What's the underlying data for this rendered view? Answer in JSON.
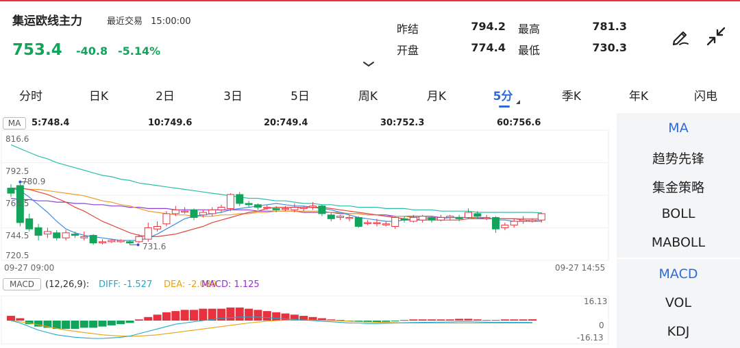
{
  "header": {
    "title": "集运欧线主力",
    "status_label": "最近交易",
    "status_time": "15:00:00",
    "price": "753.4",
    "change": "-40.8",
    "change_pct": "-5.14%",
    "quote": {
      "prev_settle_label": "昨结",
      "prev_settle": "794.2",
      "high_label": "最高",
      "high": "781.3",
      "open_label": "开盘",
      "open": "774.4",
      "low_label": "最低",
      "low": "730.3"
    },
    "icons": [
      "draw-pen-icon",
      "collapse-icon",
      "chevron-down-icon"
    ]
  },
  "tabs": [
    {
      "label": "分时"
    },
    {
      "label": "日K"
    },
    {
      "label": "2日"
    },
    {
      "label": "3日"
    },
    {
      "label": "5日"
    },
    {
      "label": "周K"
    },
    {
      "label": "月K"
    },
    {
      "label": "5分",
      "active": true
    },
    {
      "label": "季K"
    },
    {
      "label": "年K"
    },
    {
      "label": "闪电"
    }
  ],
  "ma_indicator": {
    "tag": "MA",
    "values": [
      {
        "text": "5:748.4",
        "color": "#3d8ee0"
      },
      {
        "text": "10:749.6",
        "color": "#e0463e"
      },
      {
        "text": "20:749.4",
        "color": "#f09a2a"
      },
      {
        "text": "30:752.3",
        "color": "#1f3fb8"
      },
      {
        "text": "60:756.6",
        "color": "#2bbfa6"
      }
    ]
  },
  "macd_indicator": {
    "tag": "MACD",
    "params": "(12,26,9):",
    "diff": "DIFF: -1.527",
    "dea": "DEA: -2.089",
    "macd": "MACD: 1.125",
    "diff_color": "#22a8c9",
    "dea_color": "#e8a20f",
    "macd_color": "#9b2fd0"
  },
  "axis": {
    "price_ticks": [
      "816.6",
      "792.5",
      "768.5",
      "744.5",
      "720.5"
    ],
    "time_start": "09-27 09:00",
    "time_end": "09-27 14:55",
    "macd_ticks": [
      "16.13",
      "0",
      "-16.13"
    ],
    "max_label": "780.9",
    "min_label": "731.6"
  },
  "side_panel": {
    "main_items": [
      {
        "label": "MA",
        "active": true
      },
      {
        "label": "趋势先锋"
      },
      {
        "label": "集金策略"
      },
      {
        "label": "BOLL"
      },
      {
        "label": "MABOLL"
      }
    ],
    "sub_items": [
      {
        "label": "MACD",
        "active": true
      },
      {
        "label": "VOL"
      },
      {
        "label": "KDJ"
      }
    ]
  },
  "colors": {
    "up": "#e8313f",
    "down": "#13a45b",
    "accent": "#2d6ad8"
  },
  "chart_data": {
    "type": "candlestick",
    "y_range": [
      720.5,
      816.6
    ],
    "candles": [
      {
        "o": 776,
        "c": 772,
        "h": 779,
        "l": 769
      },
      {
        "o": 778,
        "c": 749,
        "h": 780.9,
        "l": 746
      },
      {
        "o": 752,
        "c": 744,
        "h": 756,
        "l": 742
      },
      {
        "o": 745,
        "c": 739,
        "h": 748,
        "l": 735
      },
      {
        "o": 740,
        "c": 742,
        "h": 745,
        "l": 737
      },
      {
        "o": 741,
        "c": 737,
        "h": 743,
        "l": 735
      },
      {
        "o": 737,
        "c": 741,
        "h": 743,
        "l": 735
      },
      {
        "o": 740,
        "c": 739,
        "h": 742,
        "l": 737
      },
      {
        "o": 737,
        "c": 738,
        "h": 742,
        "l": 735
      },
      {
        "o": 739,
        "c": 733,
        "h": 740,
        "l": 731.6
      },
      {
        "o": 734,
        "c": 734,
        "h": 736,
        "l": 732
      },
      {
        "o": 734,
        "c": 735,
        "h": 736,
        "l": 733
      },
      {
        "o": 734,
        "c": 735,
        "h": 736,
        "l": 733
      },
      {
        "o": 734,
        "c": 733,
        "h": 735,
        "l": 731.6
      },
      {
        "o": 734,
        "c": 738,
        "h": 740,
        "l": 733
      },
      {
        "o": 736,
        "c": 745,
        "h": 749,
        "l": 734
      },
      {
        "o": 744,
        "c": 746,
        "h": 750,
        "l": 742
      },
      {
        "o": 748,
        "c": 756,
        "h": 758,
        "l": 746
      },
      {
        "o": 756,
        "c": 759,
        "h": 762,
        "l": 754
      },
      {
        "o": 758,
        "c": 758,
        "h": 761,
        "l": 756
      },
      {
        "o": 759,
        "c": 753,
        "h": 760,
        "l": 751
      },
      {
        "o": 755,
        "c": 757,
        "h": 759,
        "l": 753
      },
      {
        "o": 756,
        "c": 759,
        "h": 761,
        "l": 754
      },
      {
        "o": 759,
        "c": 761,
        "h": 763,
        "l": 757
      },
      {
        "o": 760,
        "c": 771,
        "h": 772,
        "l": 758
      },
      {
        "o": 771,
        "c": 764,
        "h": 773,
        "l": 762
      },
      {
        "o": 764,
        "c": 763,
        "h": 766,
        "l": 761
      },
      {
        "o": 763,
        "c": 761,
        "h": 764,
        "l": 759
      },
      {
        "o": 761,
        "c": 761,
        "h": 763,
        "l": 759
      },
      {
        "o": 760,
        "c": 759,
        "h": 762,
        "l": 757
      },
      {
        "o": 760,
        "c": 760,
        "h": 762,
        "l": 758
      },
      {
        "o": 759,
        "c": 761,
        "h": 764,
        "l": 757
      },
      {
        "o": 760,
        "c": 761,
        "h": 762,
        "l": 758
      },
      {
        "o": 761,
        "c": 762,
        "h": 765,
        "l": 759
      },
      {
        "o": 762,
        "c": 756,
        "h": 763,
        "l": 754
      },
      {
        "o": 755,
        "c": 752,
        "h": 757,
        "l": 750
      },
      {
        "o": 753,
        "c": 754,
        "h": 755,
        "l": 751
      },
      {
        "o": 753,
        "c": 753,
        "h": 755,
        "l": 750
      },
      {
        "o": 753,
        "c": 746,
        "h": 754,
        "l": 745
      },
      {
        "o": 749,
        "c": 749,
        "h": 751,
        "l": 747
      },
      {
        "o": 749,
        "c": 749,
        "h": 752,
        "l": 746
      },
      {
        "o": 748,
        "c": 748,
        "h": 750,
        "l": 746
      },
      {
        "o": 746,
        "c": 753,
        "h": 754,
        "l": 744
      },
      {
        "o": 752,
        "c": 751,
        "h": 754,
        "l": 749
      },
      {
        "o": 750,
        "c": 753,
        "h": 755,
        "l": 749
      },
      {
        "o": 751,
        "c": 754,
        "h": 755,
        "l": 749
      },
      {
        "o": 753,
        "c": 751,
        "h": 754,
        "l": 749
      },
      {
        "o": 751,
        "c": 753,
        "h": 755,
        "l": 750
      },
      {
        "o": 753,
        "c": 754,
        "h": 755,
        "l": 751
      },
      {
        "o": 753,
        "c": 752,
        "h": 755,
        "l": 750
      },
      {
        "o": 753,
        "c": 757,
        "h": 760,
        "l": 752
      },
      {
        "o": 756,
        "c": 754,
        "h": 758,
        "l": 752
      },
      {
        "o": 753,
        "c": 753,
        "h": 755,
        "l": 751
      },
      {
        "o": 753,
        "c": 744,
        "h": 754,
        "l": 741
      },
      {
        "o": 745,
        "c": 747,
        "h": 749,
        "l": 743
      },
      {
        "o": 747,
        "c": 750,
        "h": 752,
        "l": 745
      },
      {
        "o": 750,
        "c": 751,
        "h": 754,
        "l": 748
      },
      {
        "o": 750,
        "c": 751,
        "h": 752,
        "l": 749
      },
      {
        "o": 751,
        "c": 756,
        "h": 757,
        "l": 749
      }
    ],
    "ma5": [
      776,
      774,
      769,
      763,
      757,
      750,
      744,
      741,
      739,
      738,
      737,
      736,
      735,
      735,
      735,
      737,
      740,
      744,
      748,
      752,
      754,
      755,
      756,
      757,
      759,
      760,
      761,
      762,
      763,
      764,
      763,
      762,
      762,
      761,
      760,
      759,
      757,
      755,
      753,
      752,
      751,
      750,
      750,
      751,
      751,
      752,
      752,
      752,
      753,
      753,
      753,
      753,
      753,
      751,
      751,
      750,
      750,
      750,
      750
    ],
    "ma10": [
      776,
      776,
      775,
      773,
      771,
      768,
      765,
      761,
      758,
      754,
      750,
      747,
      744,
      741,
      739,
      738,
      738,
      739,
      740,
      742,
      744,
      746,
      749,
      751,
      753,
      755,
      757,
      758,
      760,
      761,
      761,
      761,
      761,
      761,
      761,
      760,
      759,
      758,
      757,
      756,
      755,
      754,
      753,
      752,
      751,
      751,
      751,
      751,
      751,
      751,
      752,
      752,
      752,
      752,
      752,
      752,
      751,
      751,
      751
    ],
    "ma20": [
      776,
      776,
      775,
      775,
      774,
      773,
      772,
      771,
      770,
      768,
      766,
      765,
      763,
      762,
      760,
      758,
      757,
      756,
      755,
      755,
      754,
      754,
      754,
      755,
      755,
      756,
      756,
      757,
      757,
      758,
      758,
      758,
      758,
      758,
      758,
      757,
      757,
      756,
      756,
      755,
      755,
      754,
      754,
      754,
      753,
      753,
      753,
      753,
      753,
      753,
      753,
      752,
      752,
      752,
      752,
      752,
      752,
      752,
      752
    ],
    "ma30": [
      768,
      767,
      767,
      766,
      766,
      765,
      765,
      764,
      764,
      763,
      763,
      762,
      762,
      761,
      761,
      760,
      760,
      760,
      759,
      759,
      759,
      759,
      759,
      759,
      759,
      759,
      759,
      758,
      758,
      758,
      758,
      758,
      757,
      757,
      757,
      757,
      756,
      756,
      756,
      755,
      755,
      755,
      754,
      754,
      754,
      754,
      754,
      753,
      753,
      753,
      753,
      753,
      752,
      752,
      752,
      752,
      752,
      752,
      752
    ],
    "ma60": [
      810,
      807,
      804,
      801,
      799,
      796,
      794,
      792,
      790,
      788,
      786,
      785,
      783,
      782,
      780,
      779,
      778,
      777,
      776,
      775,
      774,
      773,
      772,
      771,
      770,
      769,
      768,
      768,
      767,
      766,
      766,
      765,
      764,
      764,
      763,
      763,
      762,
      762,
      761,
      761,
      761,
      760,
      760,
      760,
      759,
      759,
      759,
      758,
      758,
      758,
      758,
      757,
      757,
      757,
      757,
      757,
      757,
      757,
      756.6
    ],
    "macd": {
      "y_range": [
        -16.13,
        16.13
      ],
      "hist": [
        4,
        2,
        -3,
        -5,
        -6,
        -7,
        -7,
        -7,
        -6,
        -6,
        -5,
        -4,
        -3,
        -2,
        1,
        3,
        5,
        7,
        8,
        9,
        9,
        10,
        10,
        10,
        11,
        11,
        10,
        9,
        8,
        7,
        6,
        5,
        4,
        3,
        2,
        1,
        0.5,
        -0.5,
        -1,
        -1.5,
        -1.5,
        -1,
        -0.5,
        0.5,
        1,
        1,
        1,
        1,
        1,
        1.5,
        1.5,
        1,
        0.5,
        0.5,
        1,
        1,
        1,
        1.125
      ],
      "diff": [
        0,
        -2,
        -5,
        -8,
        -10,
        -12,
        -13,
        -14,
        -14.5,
        -15,
        -15,
        -14.5,
        -14,
        -13,
        -11,
        -9,
        -7,
        -5,
        -3,
        -2,
        -1,
        0,
        1,
        2,
        2.5,
        3,
        3,
        3,
        2.5,
        2,
        1.5,
        1,
        0.5,
        0,
        -0.5,
        -1,
        -1.5,
        -2,
        -2,
        -2.5,
        -2.5,
        -2.2,
        -2,
        -1.8,
        -1.6,
        -1.5,
        -1.4,
        -1.3,
        -1.2,
        -1,
        -1,
        -1.2,
        -1.4,
        -1.5,
        -1.5,
        -1.5,
        -1.52,
        -1.527
      ],
      "dea": [
        0,
        -1,
        -2,
        -3.5,
        -5,
        -6.5,
        -8,
        -9,
        -10,
        -11,
        -12,
        -12.5,
        -13,
        -13.2,
        -13,
        -12.5,
        -12,
        -11,
        -10,
        -9,
        -8,
        -7,
        -6,
        -5,
        -4,
        -3,
        -2,
        -1.2,
        -0.6,
        0,
        0.3,
        0.5,
        0.5,
        0.4,
        0.3,
        0.1,
        -0.2,
        -0.5,
        -0.8,
        -1.1,
        -1.4,
        -1.6,
        -1.8,
        -1.9,
        -2,
        -2.1,
        -2.1,
        -2.1,
        -2.1,
        -2.1,
        -2.1,
        -2.1,
        -2.1,
        -2.1,
        -2.1,
        -2.09,
        -2.09,
        -2.089
      ]
    }
  }
}
